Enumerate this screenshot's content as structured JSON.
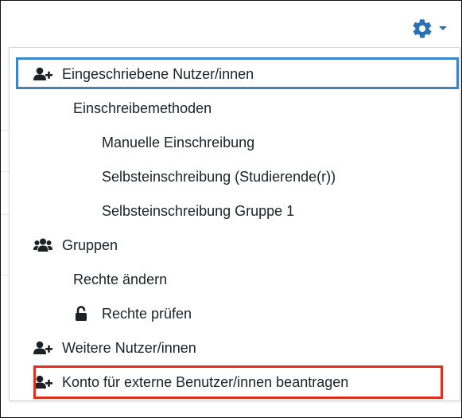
{
  "header": {
    "gear_icon": "gear-icon",
    "caret_icon": "caret-down-icon",
    "accent_color": "#2b72b4"
  },
  "menu": {
    "items": [
      {
        "label": "Eingeschriebene Nutzer/innen",
        "icon": "user-plus-icon"
      },
      {
        "label": "Einschreibemethoden"
      },
      {
        "label": "Manuelle Einschreibung"
      },
      {
        "label": "Selbsteinschreibung (Studierende(r))"
      },
      {
        "label": "Selbsteinschreibung Gruppe 1"
      },
      {
        "label": "Gruppen",
        "icon": "users-icon"
      },
      {
        "label": "Rechte ändern"
      },
      {
        "label": "Rechte prüfen",
        "icon": "unlock-icon"
      },
      {
        "label": "Weitere Nutzer/innen",
        "icon": "user-plus-icon"
      },
      {
        "label": "Konto für externe Benutzer/innen beantragen",
        "icon": "user-plus-icon"
      }
    ]
  },
  "highlights": {
    "blue": "#3d86c6",
    "red": "#e0301e"
  }
}
